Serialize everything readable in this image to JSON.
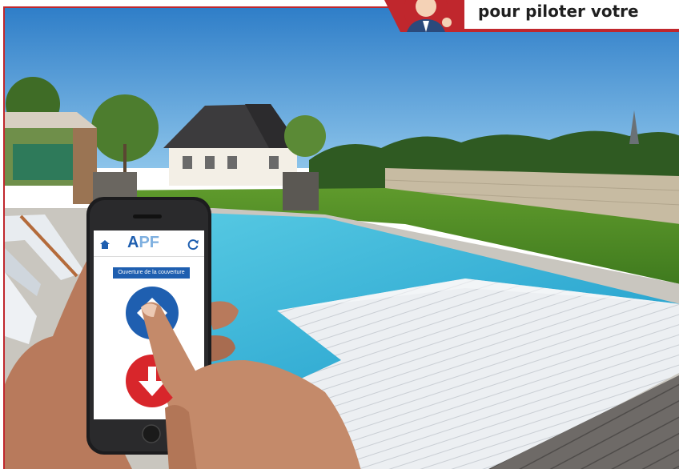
{
  "banner": {
    "text": "pour piloter votre"
  },
  "app": {
    "logo_letter_a": "A",
    "logo_letters_pf": "PF",
    "header_label": "Ouverture de la couverture",
    "icons": {
      "home": "home-icon",
      "refresh": "refresh-icon",
      "open": "arrow-up-diamond-icon",
      "close": "arrow-down-icon"
    },
    "colors": {
      "accent_blue": "#1f5fb0",
      "stop_red": "#d8262b"
    }
  },
  "colors": {
    "frame_red": "#c0272d",
    "pool_water": "#3db6d6",
    "sky": "#3f8fd0"
  }
}
